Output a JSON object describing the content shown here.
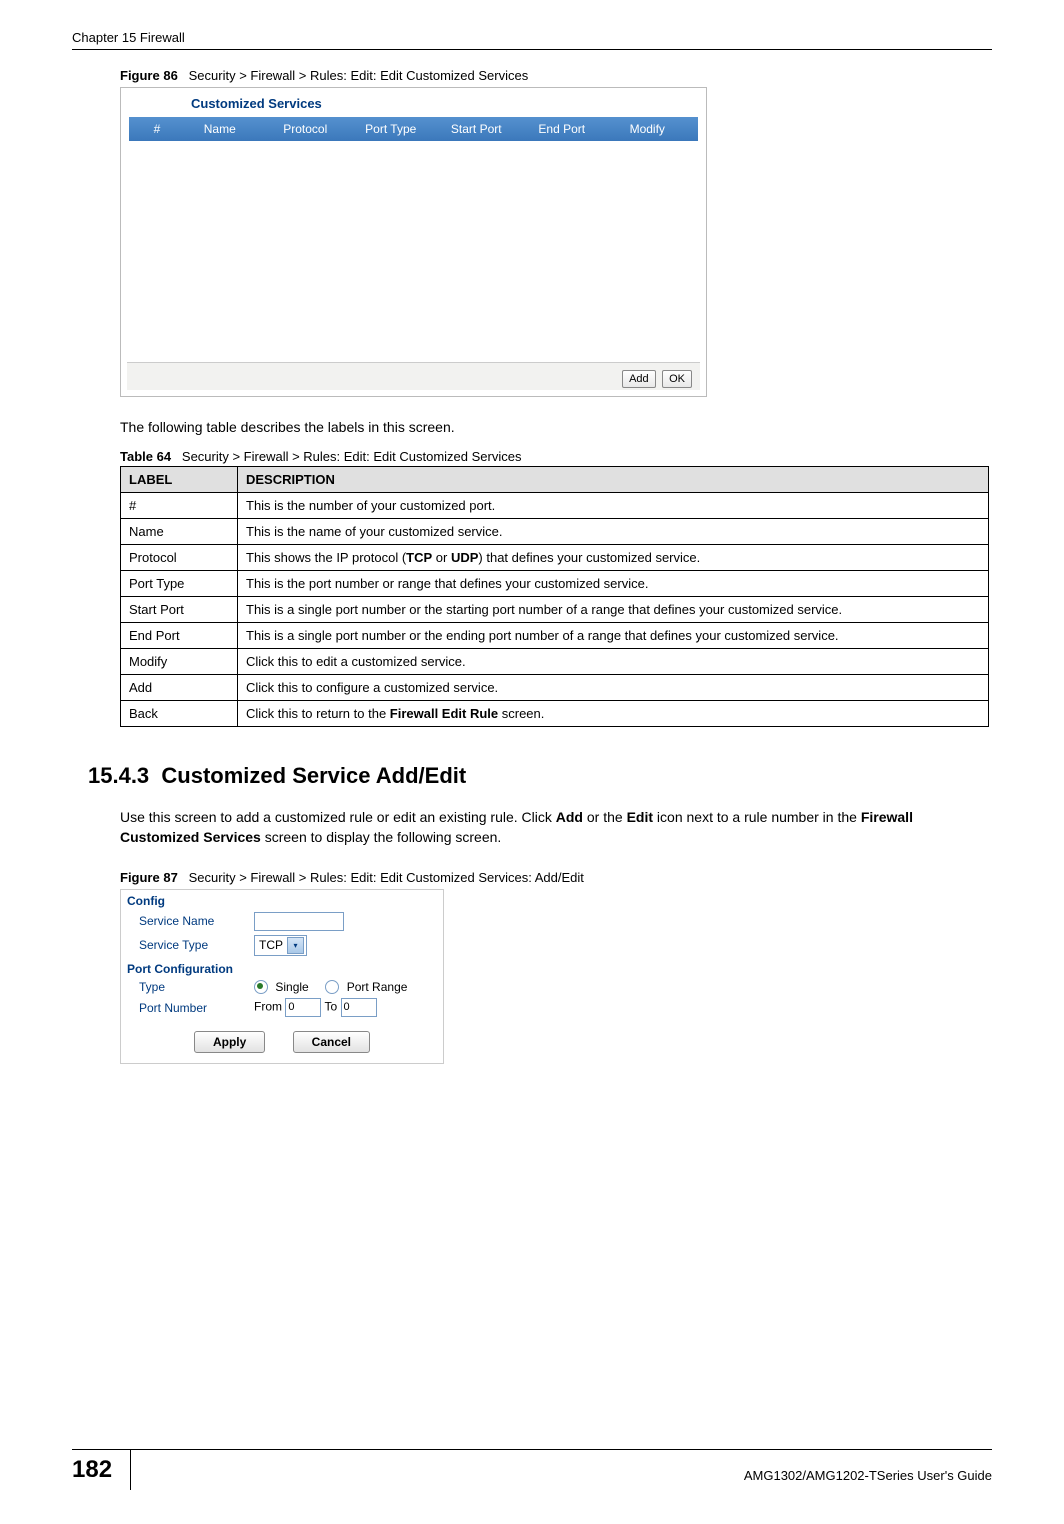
{
  "chapter_header": "Chapter 15 Firewall",
  "figure86": {
    "label": "Figure 86",
    "caption": "Security > Firewall > Rules: Edit: Edit Customized Services",
    "panel_title": "Customized Services",
    "columns": {
      "num": "#",
      "name": "Name",
      "protocol": "Protocol",
      "porttype": "Port Type",
      "startport": "Start Port",
      "endport": "End Port",
      "modify": "Modify"
    },
    "add_btn": "Add",
    "ok_btn": "OK"
  },
  "intro_text": "The following table describes the labels in this screen.",
  "table64": {
    "caption_label": "Table 64",
    "caption": "Security > Firewall > Rules: Edit: Edit Customized Services",
    "head_label": "LABEL",
    "head_desc": "DESCRIPTION",
    "rows": [
      {
        "label": "#",
        "desc": "This is the number of your customized port."
      },
      {
        "label": "Name",
        "desc": "This is the name of your customized service."
      },
      {
        "label": "Protocol",
        "desc_pre": "This shows the IP protocol (",
        "desc_b1": "TCP",
        "desc_mid": " or ",
        "desc_b2": "UDP",
        "desc_post": ") that defines your customized service."
      },
      {
        "label": "Port Type",
        "desc": "This is the port number or range that defines your customized service."
      },
      {
        "label": "Start Port",
        "desc": "This is a single port number or the starting port number of a range that defines your customized service."
      },
      {
        "label": "End Port",
        "desc": "This is a single port number or the ending port number of a range that defines your customized service."
      },
      {
        "label": "Modify",
        "desc": "Click this to edit a customized service."
      },
      {
        "label": "Add",
        "desc": "Click this to configure a customized service."
      },
      {
        "label": "Back",
        "desc_pre2": "Click this to return to the ",
        "desc_b3": "Firewall Edit Rule",
        "desc_post2": " screen."
      }
    ]
  },
  "section": {
    "number": "15.4.3",
    "title": "Customized Service Add/Edit"
  },
  "section_para_pre": "Use this screen to add a customized rule or edit an existing rule. Click ",
  "section_para_b1": "Add",
  "section_para_mid1": " or the ",
  "section_para_b2": "Edit",
  "section_para_mid2": " icon next to a rule number in the ",
  "section_para_b3": "Firewall Customized Services",
  "section_para_post": " screen to display the following screen.",
  "figure87": {
    "label": "Figure 87",
    "caption": "Security > Firewall > Rules: Edit: Edit Customized Services: Add/Edit",
    "config_heading": "Config",
    "service_name": "Service Name",
    "service_type": "Service Type",
    "service_type_value": "TCP",
    "port_config_heading": "Port Configuration",
    "type_label": "Type",
    "single": "Single",
    "port_range": "Port Range",
    "port_number": "Port Number",
    "from": "From",
    "to": "To",
    "from_val": "0",
    "to_val": "0",
    "apply": "Apply",
    "cancel": "Cancel"
  },
  "page_number": "182",
  "guide": "AMG1302/AMG1202-TSeries User's Guide"
}
